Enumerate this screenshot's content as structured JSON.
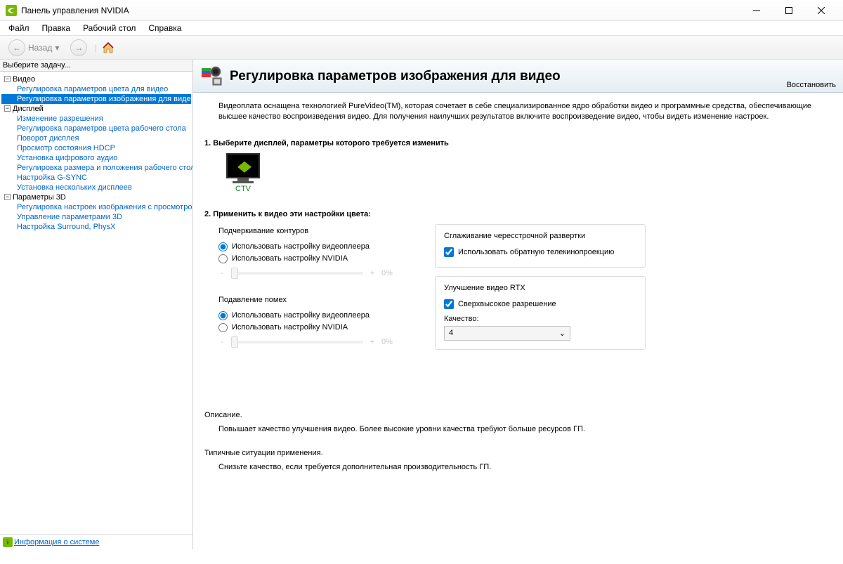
{
  "window": {
    "title": "Панель управления NVIDIA"
  },
  "menu": {
    "file": "Файл",
    "edit": "Правка",
    "desktop": "Рабочий стол",
    "help": "Справка"
  },
  "toolbar": {
    "back": "Назад"
  },
  "sidebar": {
    "select_task": "Выберите задачу...",
    "video": {
      "label": "Видео",
      "items": [
        "Регулировка параметров цвета для видео",
        "Регулировка параметров изображения для видео"
      ]
    },
    "display": {
      "label": "Дисплей",
      "items": [
        "Изменение разрешения",
        "Регулировка параметров цвета рабочего стола",
        "Поворот дисплея",
        "Просмотр состояния HDCP",
        "Установка цифрового аудио",
        "Регулировка размера и положения рабочего стола",
        "Настройка G-SYNC",
        "Установка нескольких дисплеев"
      ]
    },
    "params3d": {
      "label": "Параметры 3D",
      "items": [
        "Регулировка настроек изображения с просмотром",
        "Управление параметрами 3D",
        "Настройка Surround, PhysX"
      ]
    },
    "sysinfo": "Информация о системе"
  },
  "page": {
    "title": "Регулировка параметров изображения для видео",
    "restore": "Восстановить",
    "intro": "Видеоплата оснащена технологией PureVideo(TM), которая сочетает в себе специализированное ядро обработки видео и программные средства, обеспечивающие высшее качество воспроизведения видео. Для получения наилучших результатов включите воспроизведение видео, чтобы видеть изменение настроек.",
    "step1": "1. Выберите дисплей, параметры которого требуется изменить",
    "monitor": "CTV",
    "step2": "2. Применить к видео эти настройки цвета:",
    "edges": {
      "title": "Подчеркивание контуров",
      "opt1": "Использовать настройку видеоплеера",
      "opt2": "Использовать настройку NVIDIA",
      "pct": "0%"
    },
    "noise": {
      "title": "Подавление помех",
      "opt1": "Использовать настройку видеоплеера",
      "opt2": "Использовать настройку NVIDIA",
      "pct": "0%"
    },
    "deint": {
      "title": "Сглаживание чересстрочной развертки",
      "opt": "Использовать обратную телекинопроекцию"
    },
    "rtx": {
      "title": "Улучшение видео RTX",
      "opt": "Сверхвысокое разрешение",
      "quality_label": "Качество:",
      "quality_value": "4"
    },
    "desc": {
      "h1": "Описание.",
      "t1": "Повышает качество улучшения видео.  Более высокие уровни качества требуют больше ресурсов ГП.",
      "h2": "Типичные ситуации применения.",
      "t2": "Снизьте качество, если требуется дополнительная производительность ГП."
    }
  }
}
